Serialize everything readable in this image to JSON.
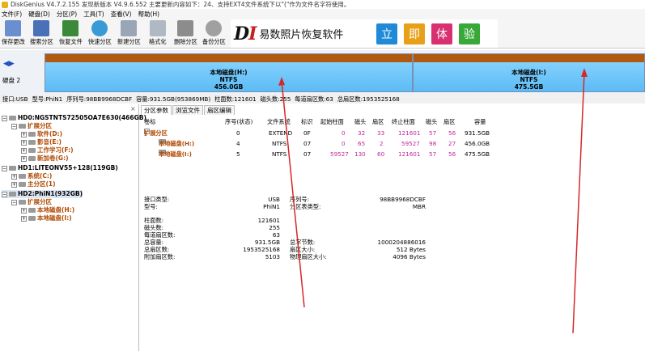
{
  "title": "DiskGenius V4.7.2.155   发现新版本 V4.9.6.552 主要更新内容如下：24、支持EXT4文件系统下以\"(\"作为文件名字符使用。",
  "menu": [
    "文件(F)",
    "硬盘(D)",
    "分区(P)",
    "工具(T)",
    "查看(V)",
    "帮助(H)"
  ],
  "toolbar": [
    "保存更改",
    "搜索分区",
    "恢复文件",
    "快速分区",
    "新建分区",
    "格式化",
    "删除分区",
    "备份分区"
  ],
  "banner": {
    "logo_a": "D",
    "logo_b": "I",
    "text": "易数照片恢复软件",
    "boxes": [
      "立",
      "即",
      "体",
      "验"
    ]
  },
  "diskmap": {
    "disk_label": "硬盘 2",
    "partitions": [
      {
        "name": "本地磁盘(H:)",
        "fs": "NTFS",
        "size": "456.0GB"
      },
      {
        "name": "本地磁盘(I:)",
        "fs": "NTFS",
        "size": "475.5GB"
      }
    ]
  },
  "infobar": [
    "接口:USB",
    "型号:PhiN1",
    "序列号:98BB9968DCBF",
    "容量:931.5GB(953869MB)",
    "柱面数:121601",
    "磁头数:255",
    "每道扇区数:63",
    "总扇区数:1953525168"
  ],
  "tree": [
    {
      "text": "HD0:NGSTNTS72505OA7E630(466GB)",
      "kind": "disk"
    },
    {
      "text": "扩展分区",
      "kind": "ext"
    },
    {
      "text": "软件(D:)",
      "kind": "vol"
    },
    {
      "text": "影音(E:)",
      "kind": "vol"
    },
    {
      "text": "工作学习(F:)",
      "kind": "vol"
    },
    {
      "text": "新加卷(G:)",
      "kind": "vol"
    },
    {
      "text": "HD1:LITEONV55+128(119GB)",
      "kind": "disk"
    },
    {
      "text": "系统(C:)",
      "kind": "vol1"
    },
    {
      "text": "主分区(1)",
      "kind": "vol1"
    },
    {
      "text": "HD2:PhiN1(932GB)",
      "kind": "disk"
    },
    {
      "text": "扩展分区",
      "kind": "ext"
    },
    {
      "text": "本地磁盘(H:)",
      "kind": "vol"
    },
    {
      "text": "本地磁盘(I:)",
      "kind": "vol"
    }
  ],
  "tabs": [
    "分区参数",
    "浏览文件",
    "扇区编辑"
  ],
  "ptable": {
    "headers": [
      "卷标",
      "序号(状态)",
      "文件系统",
      "标识",
      "起始柱面",
      "磁头",
      "扇区",
      "终止柱面",
      "磁头",
      "扇区",
      "容量"
    ],
    "rows": [
      [
        "扩展分区",
        "0",
        "EXTEND",
        "0F",
        "0",
        "32",
        "33",
        "121601",
        "57",
        "56",
        "931.5GB"
      ],
      [
        "本地磁盘(H:)",
        "4",
        "NTFS",
        "07",
        "0",
        "65",
        "2",
        "59527",
        "98",
        "27",
        "456.0GB"
      ],
      [
        "本地磁盘(I:)",
        "5",
        "NTFS",
        "07",
        "59527",
        "130",
        "60",
        "121601",
        "57",
        "56",
        "475.5GB"
      ]
    ]
  },
  "details": {
    "left": [
      [
        "接口类型:",
        "USB"
      ],
      [
        "型号:",
        "PhiN1"
      ],
      [
        "",
        ""
      ],
      [
        "柱面数:",
        "121601"
      ],
      [
        "磁头数:",
        "255"
      ],
      [
        "每道扇区数:",
        "63"
      ],
      [
        "总容量:",
        "931.5GB"
      ],
      [
        "总扇区数:",
        "1953525168"
      ],
      [
        "附加扇区数:",
        "5103"
      ]
    ],
    "right": [
      [
        "序列号:",
        "98BB9968DCBF"
      ],
      [
        "分区表类型:",
        "MBR"
      ],
      [
        "",
        ""
      ],
      [
        "",
        ""
      ],
      [
        "",
        ""
      ],
      [
        "",
        ""
      ],
      [
        "总字节数:",
        "1000204886016"
      ],
      [
        "扇区大小:",
        "512 Bytes"
      ],
      [
        "物理扇区大小:",
        "4096 Bytes"
      ]
    ]
  },
  "colors": {
    "partition_top": "#b05a10",
    "partition_body": "#5bbcf5",
    "annotation": "#d62828",
    "orange_text": "#b04800"
  }
}
